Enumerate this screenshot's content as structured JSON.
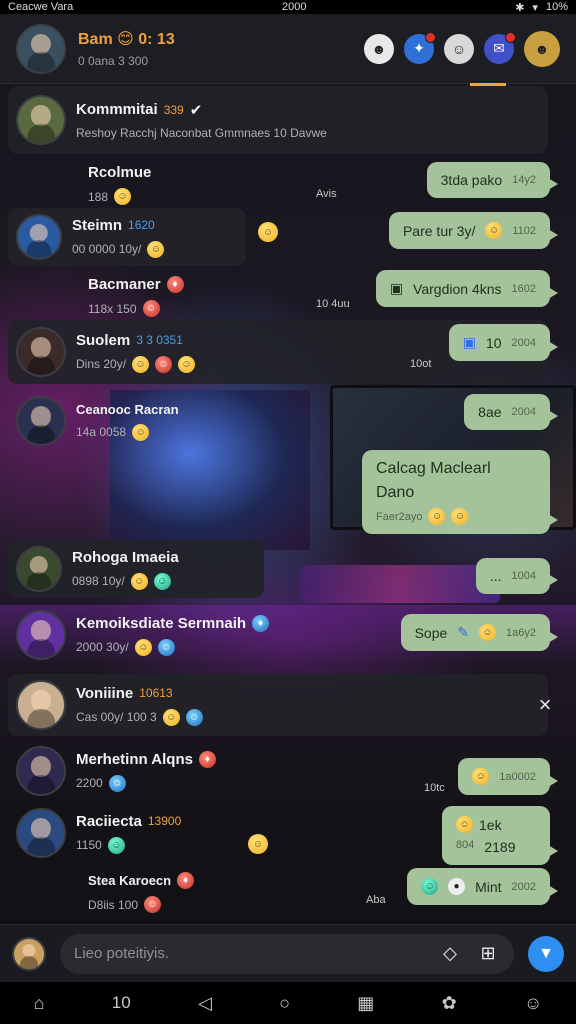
{
  "status_bar": {
    "left": "Ceacwe Vara",
    "center": "2000",
    "right": "10%"
  },
  "header": {
    "title": "Bam 😊 0: 13",
    "subtitle": "0 0ana 3 300"
  },
  "chats": [
    {
      "name": "Kommmitai",
      "tag": "339",
      "meta": "Reshoy  Racchj Naconbat Gmmnaes  10  Davwe"
    },
    {
      "name": "Rcolmue",
      "meta": "188"
    },
    {
      "name": "Steimn",
      "tag": "1620",
      "meta": "00 0000   10y/"
    },
    {
      "name": "Bacmaner",
      "meta": "118x 150"
    },
    {
      "name": "Suolem",
      "tag": "3 3 0351",
      "meta": "Dins 20y/"
    },
    {
      "name": "Ceanooc Racran",
      "meta": "14a 0058"
    },
    {
      "name": "Rohoga Imaeia",
      "meta": "0898 10y/"
    },
    {
      "name": "Kemoiksdiate Sermnaih",
      "meta": "2000 30y/"
    },
    {
      "name": "Voniiine",
      "tag": "10613",
      "meta": "Cas 00y/  100  3"
    },
    {
      "name": "Merhetinn Alqns",
      "meta": "2200"
    },
    {
      "name": "Raciiecta",
      "tag": "13900",
      "meta": "1150"
    },
    {
      "name": "Stea Karoecn",
      "meta": "D8iis 100"
    }
  ],
  "messages": [
    {
      "text": "3tda pako",
      "time": "14y2",
      "side_time": "Avis"
    },
    {
      "text": "Pare tur 3y/",
      "time": "1102"
    },
    {
      "text": "Vargdion 4kns",
      "time": "1602",
      "side_time": "10 4uu"
    },
    {
      "text": "10",
      "time": "2004",
      "side_time": "10ot"
    },
    {
      "text": "8ae",
      "time": "2004"
    },
    {
      "text": "Calcag Maclearl",
      "line2": "Dano",
      "time": "Faer2ayo"
    },
    {
      "text": "...",
      "time": "1004"
    },
    {
      "text": "Sope",
      "time": "1a6y2"
    },
    {
      "text": "",
      "time": "1a0002",
      "side_time": "10tc"
    },
    {
      "text": "1ek",
      "line2": "2189",
      "time": "804"
    },
    {
      "text": "Mint",
      "time": "2002",
      "side_time": "Aba"
    }
  ],
  "composer": {
    "placeholder": "Lieo poteitiyis."
  },
  "bottom_nav": {
    "label": "10"
  },
  "colors": {
    "accent": "#f0a040",
    "bubble": "#a5c39a",
    "send": "#2e8ff0"
  },
  "icons": [
    "search-icon",
    "notification-icon",
    "close-icon",
    "send-icon",
    "tag-icon",
    "grid-icon",
    "home-icon",
    "back-icon",
    "circle-icon"
  ]
}
